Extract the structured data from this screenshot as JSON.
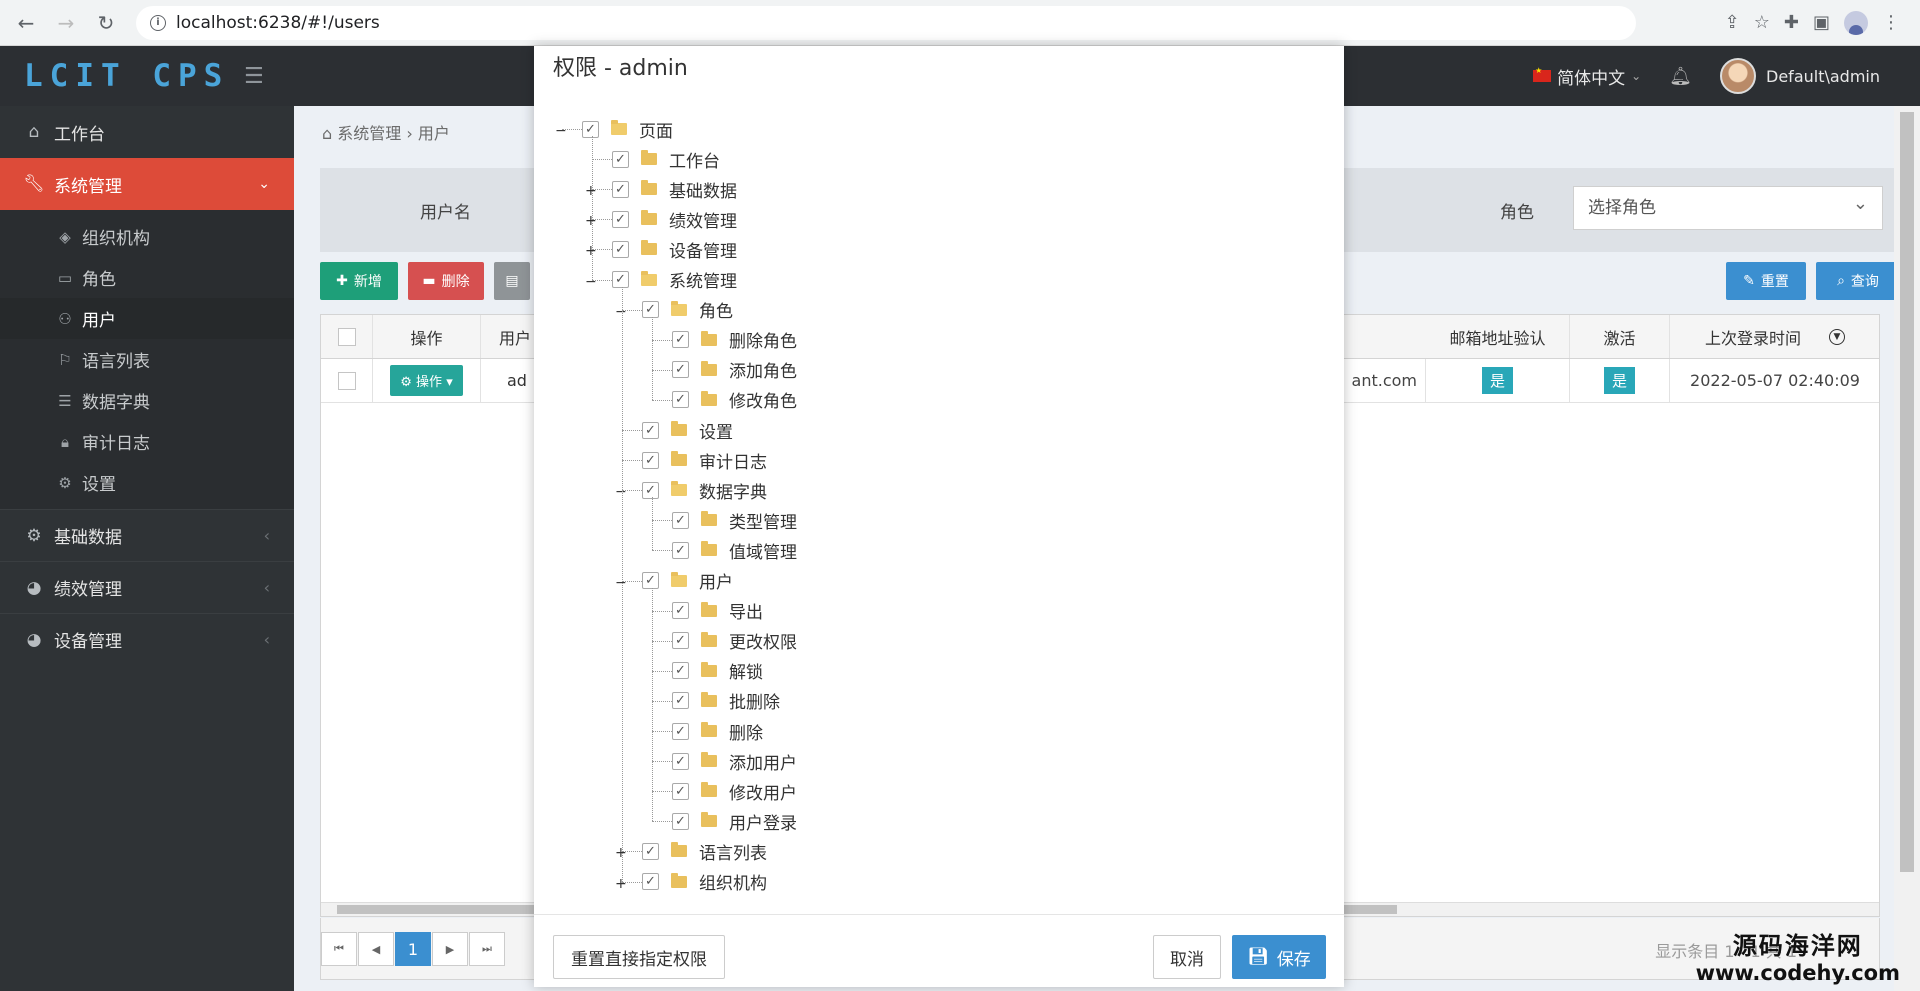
{
  "browser": {
    "url": "localhost:6238/#!/users",
    "icons": [
      "back-icon",
      "forward-icon",
      "reload-icon",
      "info-icon",
      "share-icon",
      "star-icon",
      "extensions-icon",
      "sidebar-icon",
      "profile-icon",
      "menu-icon"
    ]
  },
  "app": {
    "logo": "LCIT CPS",
    "language": "简体中文",
    "username": "Default\\admin"
  },
  "sidebar": {
    "items": [
      {
        "label": "工作台",
        "icon": "home-icon"
      },
      {
        "label": "系统管理",
        "icon": "wrench-icon"
      }
    ],
    "sub_items": [
      {
        "label": "组织机构",
        "icon": "layers-icon"
      },
      {
        "label": "角色",
        "icon": "id-card-icon"
      },
      {
        "label": "用户",
        "icon": "user-icon"
      },
      {
        "label": "语言列表",
        "icon": "flag-icon"
      },
      {
        "label": "数据字典",
        "icon": "list-icon"
      },
      {
        "label": "审计日志",
        "icon": "lock-icon"
      },
      {
        "label": "设置",
        "icon": "gear-icon"
      }
    ],
    "groups": [
      {
        "label": "基础数据",
        "icon": "gear-icon"
      },
      {
        "label": "绩效管理",
        "icon": "pie-chart-icon"
      },
      {
        "label": "设备管理",
        "icon": "pie-chart-icon"
      }
    ]
  },
  "page": {
    "breadcrumb_root": "系统管理",
    "breadcrumb_leaf": "用户",
    "filter_username_label": "用户名",
    "filter_role_label": "角色",
    "filter_role_placeholder": "选择角色",
    "btn_add": "新增",
    "btn_delete": "删除",
    "btn_reset": "重置",
    "btn_query": "查询"
  },
  "grid": {
    "headers": [
      "操作",
      "用户",
      "邮箱地址验认",
      "激活",
      "上次登录时间"
    ],
    "row": {
      "op": "操作",
      "user_partial": "ad",
      "email_partial": "ant.com",
      "email_confirmed": "是",
      "active": "是",
      "last_login": "2022-05-07 02:40:09"
    },
    "pager": {
      "current": "1",
      "info": "显示条目 1 - 1 共 1"
    }
  },
  "modal": {
    "title": "权限 - admin",
    "tree": [
      {
        "label": "页面",
        "level": 0,
        "expanded": true
      },
      {
        "label": "工作台",
        "level": 1
      },
      {
        "label": "基础数据",
        "level": 1,
        "collapsed": true
      },
      {
        "label": "绩效管理",
        "level": 1,
        "collapsed": true
      },
      {
        "label": "设备管理",
        "level": 1,
        "collapsed": true
      },
      {
        "label": "系统管理",
        "level": 1,
        "expanded": true
      },
      {
        "label": "角色",
        "level": 2,
        "expanded": true
      },
      {
        "label": "删除角色",
        "level": 3
      },
      {
        "label": "添加角色",
        "level": 3
      },
      {
        "label": "修改角色",
        "level": 3
      },
      {
        "label": "设置",
        "level": 2
      },
      {
        "label": "审计日志",
        "level": 2
      },
      {
        "label": "数据字典",
        "level": 2,
        "expanded": true
      },
      {
        "label": "类型管理",
        "level": 3
      },
      {
        "label": "值域管理",
        "level": 3
      },
      {
        "label": "用户",
        "level": 2,
        "expanded": true
      },
      {
        "label": "导出",
        "level": 3
      },
      {
        "label": "更改权限",
        "level": 3
      },
      {
        "label": "解锁",
        "level": 3
      },
      {
        "label": "批删除",
        "level": 3
      },
      {
        "label": "删除",
        "level": 3
      },
      {
        "label": "添加用户",
        "level": 3
      },
      {
        "label": "修改用户",
        "level": 3
      },
      {
        "label": "用户登录",
        "level": 3
      },
      {
        "label": "语言列表",
        "level": 2,
        "collapsed": true
      },
      {
        "label": "组织机构",
        "level": 2,
        "collapsed": true
      }
    ],
    "btn_reset_permission": "重置直接指定权限",
    "btn_cancel": "取消",
    "btn_save": "保存"
  },
  "watermark": {
    "line1": "源码海洋网",
    "line2": "www.codehy.com"
  }
}
